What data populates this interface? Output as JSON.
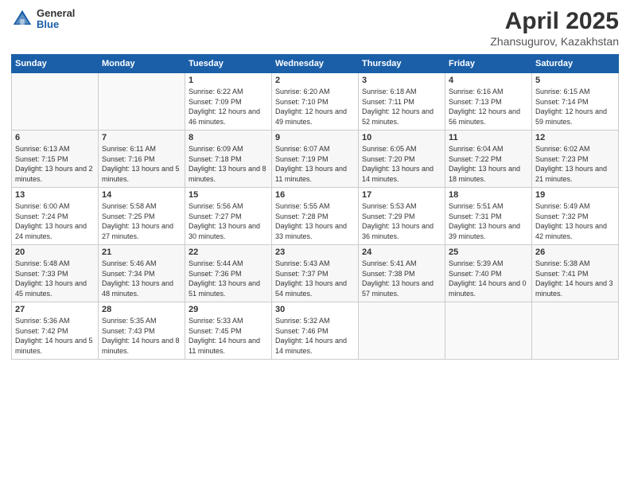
{
  "header": {
    "logo": {
      "general": "General",
      "blue": "Blue"
    },
    "title": "April 2025",
    "location": "Zhansugurov, Kazakhstan"
  },
  "calendar": {
    "columns": [
      "Sunday",
      "Monday",
      "Tuesday",
      "Wednesday",
      "Thursday",
      "Friday",
      "Saturday"
    ],
    "weeks": [
      [
        {
          "day": "",
          "sunrise": "",
          "sunset": "",
          "daylight": ""
        },
        {
          "day": "",
          "sunrise": "",
          "sunset": "",
          "daylight": ""
        },
        {
          "day": "1",
          "sunrise": "Sunrise: 6:22 AM",
          "sunset": "Sunset: 7:09 PM",
          "daylight": "Daylight: 12 hours and 46 minutes."
        },
        {
          "day": "2",
          "sunrise": "Sunrise: 6:20 AM",
          "sunset": "Sunset: 7:10 PM",
          "daylight": "Daylight: 12 hours and 49 minutes."
        },
        {
          "day": "3",
          "sunrise": "Sunrise: 6:18 AM",
          "sunset": "Sunset: 7:11 PM",
          "daylight": "Daylight: 12 hours and 52 minutes."
        },
        {
          "day": "4",
          "sunrise": "Sunrise: 6:16 AM",
          "sunset": "Sunset: 7:13 PM",
          "daylight": "Daylight: 12 hours and 56 minutes."
        },
        {
          "day": "5",
          "sunrise": "Sunrise: 6:15 AM",
          "sunset": "Sunset: 7:14 PM",
          "daylight": "Daylight: 12 hours and 59 minutes."
        }
      ],
      [
        {
          "day": "6",
          "sunrise": "Sunrise: 6:13 AM",
          "sunset": "Sunset: 7:15 PM",
          "daylight": "Daylight: 13 hours and 2 minutes."
        },
        {
          "day": "7",
          "sunrise": "Sunrise: 6:11 AM",
          "sunset": "Sunset: 7:16 PM",
          "daylight": "Daylight: 13 hours and 5 minutes."
        },
        {
          "day": "8",
          "sunrise": "Sunrise: 6:09 AM",
          "sunset": "Sunset: 7:18 PM",
          "daylight": "Daylight: 13 hours and 8 minutes."
        },
        {
          "day": "9",
          "sunrise": "Sunrise: 6:07 AM",
          "sunset": "Sunset: 7:19 PM",
          "daylight": "Daylight: 13 hours and 11 minutes."
        },
        {
          "day": "10",
          "sunrise": "Sunrise: 6:05 AM",
          "sunset": "Sunset: 7:20 PM",
          "daylight": "Daylight: 13 hours and 14 minutes."
        },
        {
          "day": "11",
          "sunrise": "Sunrise: 6:04 AM",
          "sunset": "Sunset: 7:22 PM",
          "daylight": "Daylight: 13 hours and 18 minutes."
        },
        {
          "day": "12",
          "sunrise": "Sunrise: 6:02 AM",
          "sunset": "Sunset: 7:23 PM",
          "daylight": "Daylight: 13 hours and 21 minutes."
        }
      ],
      [
        {
          "day": "13",
          "sunrise": "Sunrise: 6:00 AM",
          "sunset": "Sunset: 7:24 PM",
          "daylight": "Daylight: 13 hours and 24 minutes."
        },
        {
          "day": "14",
          "sunrise": "Sunrise: 5:58 AM",
          "sunset": "Sunset: 7:25 PM",
          "daylight": "Daylight: 13 hours and 27 minutes."
        },
        {
          "day": "15",
          "sunrise": "Sunrise: 5:56 AM",
          "sunset": "Sunset: 7:27 PM",
          "daylight": "Daylight: 13 hours and 30 minutes."
        },
        {
          "day": "16",
          "sunrise": "Sunrise: 5:55 AM",
          "sunset": "Sunset: 7:28 PM",
          "daylight": "Daylight: 13 hours and 33 minutes."
        },
        {
          "day": "17",
          "sunrise": "Sunrise: 5:53 AM",
          "sunset": "Sunset: 7:29 PM",
          "daylight": "Daylight: 13 hours and 36 minutes."
        },
        {
          "day": "18",
          "sunrise": "Sunrise: 5:51 AM",
          "sunset": "Sunset: 7:31 PM",
          "daylight": "Daylight: 13 hours and 39 minutes."
        },
        {
          "day": "19",
          "sunrise": "Sunrise: 5:49 AM",
          "sunset": "Sunset: 7:32 PM",
          "daylight": "Daylight: 13 hours and 42 minutes."
        }
      ],
      [
        {
          "day": "20",
          "sunrise": "Sunrise: 5:48 AM",
          "sunset": "Sunset: 7:33 PM",
          "daylight": "Daylight: 13 hours and 45 minutes."
        },
        {
          "day": "21",
          "sunrise": "Sunrise: 5:46 AM",
          "sunset": "Sunset: 7:34 PM",
          "daylight": "Daylight: 13 hours and 48 minutes."
        },
        {
          "day": "22",
          "sunrise": "Sunrise: 5:44 AM",
          "sunset": "Sunset: 7:36 PM",
          "daylight": "Daylight: 13 hours and 51 minutes."
        },
        {
          "day": "23",
          "sunrise": "Sunrise: 5:43 AM",
          "sunset": "Sunset: 7:37 PM",
          "daylight": "Daylight: 13 hours and 54 minutes."
        },
        {
          "day": "24",
          "sunrise": "Sunrise: 5:41 AM",
          "sunset": "Sunset: 7:38 PM",
          "daylight": "Daylight: 13 hours and 57 minutes."
        },
        {
          "day": "25",
          "sunrise": "Sunrise: 5:39 AM",
          "sunset": "Sunset: 7:40 PM",
          "daylight": "Daylight: 14 hours and 0 minutes."
        },
        {
          "day": "26",
          "sunrise": "Sunrise: 5:38 AM",
          "sunset": "Sunset: 7:41 PM",
          "daylight": "Daylight: 14 hours and 3 minutes."
        }
      ],
      [
        {
          "day": "27",
          "sunrise": "Sunrise: 5:36 AM",
          "sunset": "Sunset: 7:42 PM",
          "daylight": "Daylight: 14 hours and 5 minutes."
        },
        {
          "day": "28",
          "sunrise": "Sunrise: 5:35 AM",
          "sunset": "Sunset: 7:43 PM",
          "daylight": "Daylight: 14 hours and 8 minutes."
        },
        {
          "day": "29",
          "sunrise": "Sunrise: 5:33 AM",
          "sunset": "Sunset: 7:45 PM",
          "daylight": "Daylight: 14 hours and 11 minutes."
        },
        {
          "day": "30",
          "sunrise": "Sunrise: 5:32 AM",
          "sunset": "Sunset: 7:46 PM",
          "daylight": "Daylight: 14 hours and 14 minutes."
        },
        {
          "day": "",
          "sunrise": "",
          "sunset": "",
          "daylight": ""
        },
        {
          "day": "",
          "sunrise": "",
          "sunset": "",
          "daylight": ""
        },
        {
          "day": "",
          "sunrise": "",
          "sunset": "",
          "daylight": ""
        }
      ]
    ]
  }
}
